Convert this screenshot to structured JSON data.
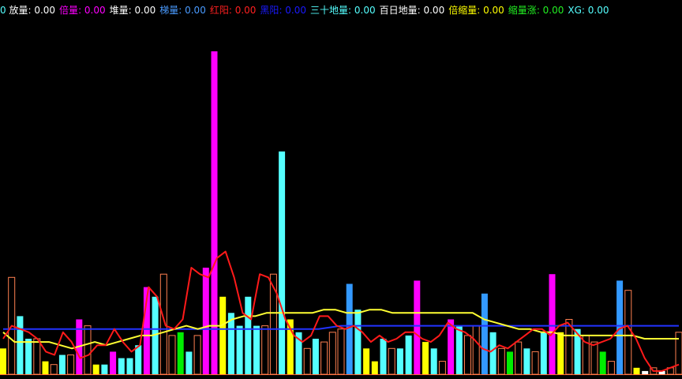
{
  "legend": [
    {
      "name": "放量",
      "value": "0.00",
      "color": "#ffffff",
      "prefix": "0 "
    },
    {
      "name": "倍量",
      "value": "0.00",
      "color": "#ff00ff"
    },
    {
      "name": "堆量",
      "value": "0.00",
      "color": "#ffffff"
    },
    {
      "name": "梯量",
      "value": "0.00",
      "color": "#4a9bff"
    },
    {
      "name": "红阳",
      "value": "0.00",
      "color": "#ff2020"
    },
    {
      "name": "黑阳",
      "value": "0.00",
      "color": "#1a1aff"
    },
    {
      "name": "三十地量",
      "value": "0.00",
      "color": "#55ffff"
    },
    {
      "name": "百日地量",
      "value": "0.00",
      "color": "#ffffff"
    },
    {
      "name": "倍缩量",
      "value": "0.00",
      "color": "#ffff00"
    },
    {
      "name": "缩量涨",
      "value": "0.00",
      "color": "#22ee22"
    },
    {
      "name": "XG",
      "value": "0.00",
      "color": "#55ffff"
    }
  ],
  "legend_value_color": "#55ffff",
  "chart_data": {
    "type": "bar",
    "ylim": [
      0,
      100
    ],
    "colors": {
      "cyan": "#55ffff",
      "magenta": "#ff00ff",
      "yellow": "#ffff00",
      "green": "#00ee00",
      "blue": "#3399ff",
      "white": "#ffffff",
      "hollow": "#ff7f50",
      "red_line": "#ff1a1a",
      "yellow_line": "#ffff33",
      "blue_line": "#2233ff"
    },
    "bars": [
      {
        "c": "yellow",
        "v": 8
      },
      {
        "c": "hollow",
        "v": 30
      },
      {
        "c": "cyan",
        "v": 18
      },
      {
        "c": "cyan",
        "v": 11
      },
      {
        "c": "hollow",
        "v": 11
      },
      {
        "c": "yellow",
        "v": 4
      },
      {
        "c": "hollow",
        "v": 3
      },
      {
        "c": "cyan",
        "v": 6
      },
      {
        "c": "hollow",
        "v": 6
      },
      {
        "c": "magenta",
        "v": 17
      },
      {
        "c": "hollow",
        "v": 15
      },
      {
        "c": "yellow",
        "v": 3
      },
      {
        "c": "cyan",
        "v": 3
      },
      {
        "c": "magenta",
        "v": 7
      },
      {
        "c": "cyan",
        "v": 5
      },
      {
        "c": "cyan",
        "v": 5
      },
      {
        "c": "cyan",
        "v": 9
      },
      {
        "c": "magenta",
        "v": 27
      },
      {
        "c": "cyan",
        "v": 24
      },
      {
        "c": "hollow",
        "v": 31
      },
      {
        "c": "hollow",
        "v": 12
      },
      {
        "c": "green",
        "v": 13
      },
      {
        "c": "cyan",
        "v": 7
      },
      {
        "c": "hollow",
        "v": 12
      },
      {
        "c": "magenta",
        "v": 33
      },
      {
        "c": "magenta",
        "v": 100
      },
      {
        "c": "yellow",
        "v": 24
      },
      {
        "c": "cyan",
        "v": 19
      },
      {
        "c": "cyan",
        "v": 15
      },
      {
        "c": "cyan",
        "v": 24
      },
      {
        "c": "cyan",
        "v": 15
      },
      {
        "c": "hollow",
        "v": 15
      },
      {
        "c": "hollow",
        "v": 31
      },
      {
        "c": "cyan",
        "v": 69
      },
      {
        "c": "yellow",
        "v": 17
      },
      {
        "c": "cyan",
        "v": 13
      },
      {
        "c": "hollow",
        "v": 8
      },
      {
        "c": "cyan",
        "v": 11
      },
      {
        "c": "hollow",
        "v": 10
      },
      {
        "c": "hollow",
        "v": 13
      },
      {
        "c": "hollow",
        "v": 14
      },
      {
        "c": "blue",
        "v": 28
      },
      {
        "c": "cyan",
        "v": 20
      },
      {
        "c": "yellow",
        "v": 8
      },
      {
        "c": "yellow",
        "v": 4
      },
      {
        "c": "cyan",
        "v": 11
      },
      {
        "c": "hollow",
        "v": 8
      },
      {
        "c": "cyan",
        "v": 8
      },
      {
        "c": "cyan",
        "v": 12
      },
      {
        "c": "magenta",
        "v": 29
      },
      {
        "c": "yellow",
        "v": 10
      },
      {
        "c": "cyan",
        "v": 8
      },
      {
        "c": "hollow",
        "v": 4
      },
      {
        "c": "magenta",
        "v": 17
      },
      {
        "c": "cyan",
        "v": 15
      },
      {
        "c": "hollow",
        "v": 12
      },
      {
        "c": "hollow",
        "v": 15
      },
      {
        "c": "blue",
        "v": 25
      },
      {
        "c": "cyan",
        "v": 13
      },
      {
        "c": "hollow",
        "v": 8
      },
      {
        "c": "green",
        "v": 7
      },
      {
        "c": "hollow",
        "v": 10
      },
      {
        "c": "cyan",
        "v": 8
      },
      {
        "c": "hollow",
        "v": 7
      },
      {
        "c": "cyan",
        "v": 13
      },
      {
        "c": "magenta",
        "v": 31
      },
      {
        "c": "yellow",
        "v": 13
      },
      {
        "c": "hollow",
        "v": 17
      },
      {
        "c": "cyan",
        "v": 14
      },
      {
        "c": "hollow",
        "v": 12
      },
      {
        "c": "hollow",
        "v": 10
      },
      {
        "c": "green",
        "v": 7
      },
      {
        "c": "hollow",
        "v": 4
      },
      {
        "c": "blue",
        "v": 29
      },
      {
        "c": "hollow",
        "v": 26
      },
      {
        "c": "yellow",
        "v": 2
      },
      {
        "c": "white",
        "v": 1
      },
      {
        "c": "hollow",
        "v": 2
      },
      {
        "c": "white",
        "v": 1
      },
      {
        "c": "hollow",
        "v": 2
      },
      {
        "c": "hollow",
        "v": 13
      }
    ],
    "lines": {
      "red": [
        11,
        15,
        14,
        13,
        11,
        7,
        6,
        13,
        10,
        5,
        6,
        9,
        9,
        14,
        10,
        7,
        9,
        27,
        24,
        15,
        14,
        17,
        33,
        31,
        30,
        36,
        38,
        30,
        19,
        17,
        31,
        30,
        25,
        17,
        12,
        10,
        12,
        18,
        18,
        15,
        14,
        15,
        13,
        10,
        12,
        10,
        11,
        13,
        13,
        11,
        10,
        12,
        16,
        14,
        13,
        11,
        8,
        7,
        9,
        8,
        10,
        12,
        14,
        14,
        12,
        15,
        16,
        13,
        10,
        9,
        10,
        11,
        14,
        15,
        11,
        5,
        1,
        1,
        2,
        3
      ],
      "yellow": [
        13,
        10,
        10,
        10,
        10,
        9,
        8,
        9,
        10,
        9,
        10,
        11,
        12,
        12,
        13,
        14,
        15,
        14,
        15,
        15,
        17,
        18,
        18,
        19,
        19,
        19,
        19,
        19,
        20,
        20,
        19,
        19,
        20,
        20,
        19,
        19,
        19,
        19,
        19,
        19,
        19,
        19,
        17,
        16,
        15,
        14,
        14,
        13,
        13,
        12,
        12,
        12,
        12,
        12,
        12,
        12,
        11,
        11,
        11,
        11
      ],
      "blue": [
        14,
        14,
        14,
        14,
        14,
        14,
        14,
        14,
        14,
        14,
        14,
        14,
        14,
        14,
        14,
        15,
        15,
        15,
        15,
        15,
        15,
        15,
        15,
        15,
        15,
        15,
        15,
        15,
        15,
        15,
        15
      ]
    }
  }
}
